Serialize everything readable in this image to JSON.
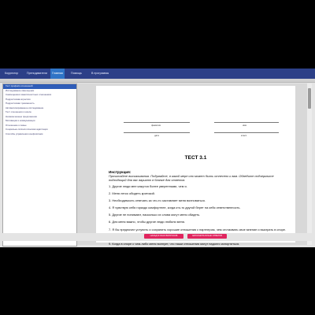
{
  "menu": {
    "items": [
      "Корректор",
      "Преподаватели",
      "Главная",
      "Помощь",
      "В программы"
    ],
    "active_index": 2
  },
  "sidebar": {
    "items": [
      "Тест профиля отношений",
      "Исследование самооценки",
      "Самооценка в межличностных отношениях",
      "Подростковая агрессия",
      "Подростковая тревожность",
      "Автоматизированное исследование",
      "Тест отношения к школе",
      "Незаконченные предложения",
      "Мотивация и коммуникация",
      "Отношение к семье",
      "Социально-психологическая адаптация",
      "Способы управления конфликтами"
    ],
    "selected_index": 0
  },
  "form": {
    "surname_label": "фамилия",
    "name_label": "имя",
    "date_label": "дата",
    "class_label": "класс"
  },
  "test": {
    "title": "ТЕСТ 3.1",
    "instruction_title": "Инструкция:",
    "instruction_text": "Прочитайте высказывания. Подумайте, в какой мере оно может быть отнесено к вам. Обведите подчеркните подходящий для вас вариант в бланке для ответов.",
    "questions": [
      "1. Другие люди мне кажутся более уверенными, чем я.",
      "2. Меня легко обидеть критикой.",
      "3. Необходимость отвечать за что-то заставляет меня волноваться.",
      "4. Я чувствую себя гораздо комфортнее, когда кто-то другой берет на себя ответственность.",
      "5. Другие не понимают, насколько их слова могут меня обидеть.",
      "6. Для меня важно, чтобы другие люди любили меня.",
      "7. Я бы предпочел уступить и сохранить хорошие отношения с партнером, чем отстаивать свое мнение и выиграть в споре.",
      "8. Я спокоен, когда руководит кто-то другой.",
      "9. Когда в споре с чем-либо меня волнует, что наши отношения могут надолго испортиться."
    ]
  },
  "buttons": {
    "prev_label": "НАЗАД В ОКНО ВОПРОСОВ",
    "next_label": "ЗАПОЛНИТЬ БЛАНК ОТВЕТОВ"
  },
  "colors": {
    "menubar": "#2c3f87",
    "active_tab": "#2f74c6",
    "selected_item": "#2f5db8",
    "button": "#e0245e"
  }
}
